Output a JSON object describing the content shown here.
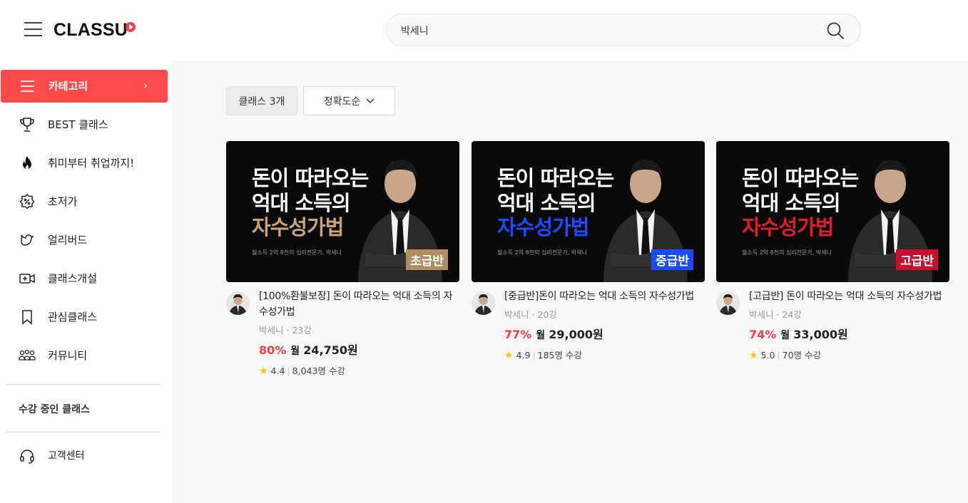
{
  "header": {
    "logo_text": "CLASSU",
    "search_value": "박세니"
  },
  "sidebar": {
    "items": [
      {
        "label": "카테고리",
        "icon": "menu-icon",
        "active": true
      },
      {
        "label": "BEST 클래스",
        "icon": "trophy-icon"
      },
      {
        "label": "취미부터 취업까지!",
        "icon": "fire-icon"
      },
      {
        "label": "초저가",
        "icon": "discount-badge-icon"
      },
      {
        "label": "얼리버드",
        "icon": "bird-icon"
      },
      {
        "label": "클래스개설",
        "icon": "video-add-icon"
      },
      {
        "label": "관심클래스",
        "icon": "bookmark-icon"
      },
      {
        "label": "커뮤니티",
        "icon": "community-icon"
      }
    ],
    "section_label": "수강 중인 클래스",
    "support_label": "고객센터"
  },
  "toolbar": {
    "count_label": "클래스 3개",
    "sort_label": "정확도순"
  },
  "thumbnail_text": {
    "line1": "돈이 따라오는",
    "line2": "억대 소득의",
    "line3": "자수성가법",
    "subtitle": "월소득 2억 8천의 심리전문가, 박세니"
  },
  "cards": [
    {
      "title": "[100%환불보장] 돈이 따라오는 억대 소득의 자수성가법",
      "level_badge": "초급반",
      "accent": "#c8a374",
      "badge_bg": "#b08d5f",
      "instructor": "박세니",
      "lectures": "23강",
      "discount": "80%",
      "month_label": "월",
      "price": "24,750원",
      "rating": "4.4",
      "students": "8,043명 수강"
    },
    {
      "title": "[중급반]돈이 따라오는 억대 소득의 자수성가법",
      "level_badge": "중급반",
      "accent": "#1a4bff",
      "badge_bg": "#1a4bff",
      "instructor": "박세니",
      "lectures": "20강",
      "discount": "77%",
      "month_label": "월",
      "price": "29,000원",
      "rating": "4.9",
      "students": "185명 수강"
    },
    {
      "title": "[고급반] 돈이 따라오는 억대 소득의 자수성가법",
      "level_badge": "고급반",
      "accent": "#e21b2b",
      "badge_bg": "#c8102e",
      "instructor": "박세니",
      "lectures": "24강",
      "discount": "74%",
      "month_label": "월",
      "price": "33,000원",
      "rating": "5.0",
      "students": "70명 수강"
    }
  ],
  "colors": {
    "brand_red": "#ff4b4b",
    "discount_red": "#ff3a4a",
    "star_yellow": "#ffc700"
  }
}
